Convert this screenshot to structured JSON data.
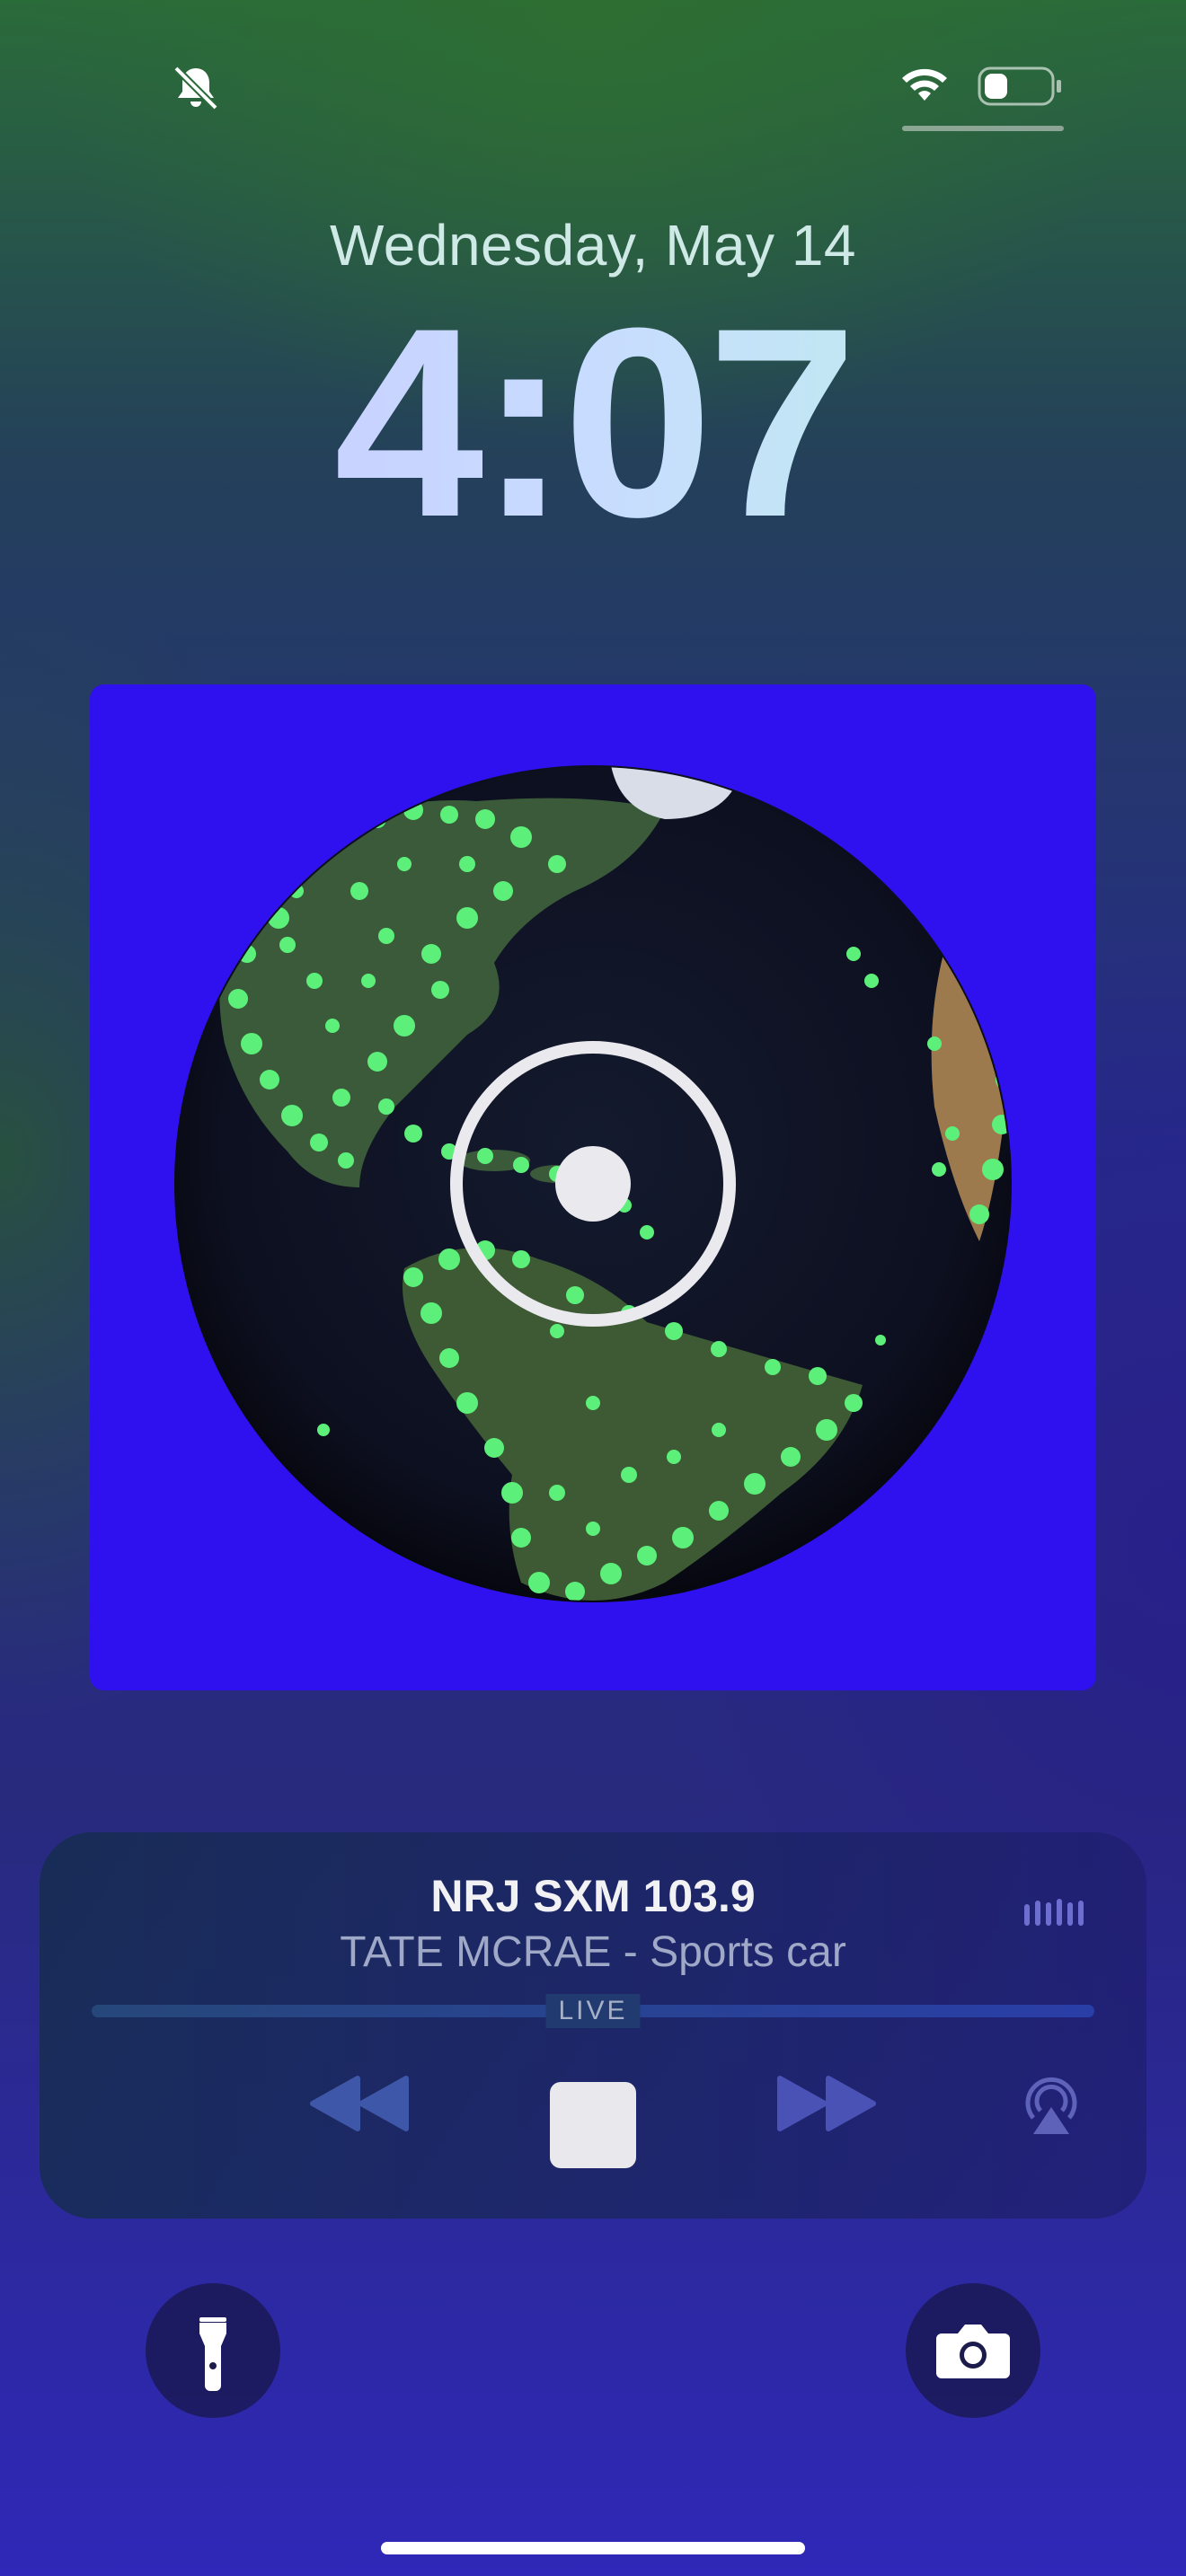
{
  "status_bar": {
    "silent_icon": "bell-slash-icon",
    "wifi_icon": "wifi-icon",
    "battery_icon": "battery-icon",
    "battery_level": 0.35
  },
  "lock_screen": {
    "date": "Wednesday, May 14",
    "time": "4:07"
  },
  "artwork": {
    "description_icon": "globe-artwork",
    "colors": {
      "background": "#2f10ee",
      "dots": "#5cf07a"
    }
  },
  "now_playing": {
    "station": "NRJ SXM 103.9",
    "track": "TATE MCRAE - Sports car",
    "progress_label": "LIVE",
    "icons": {
      "eq": "audio-waveform-icon",
      "rewind": "rewind-icon",
      "stop": "stop-icon",
      "forward": "fast-forward-icon",
      "airplay": "airplay-icon"
    }
  },
  "quick_actions": {
    "left_icon": "flashlight-icon",
    "right_icon": "camera-icon"
  }
}
